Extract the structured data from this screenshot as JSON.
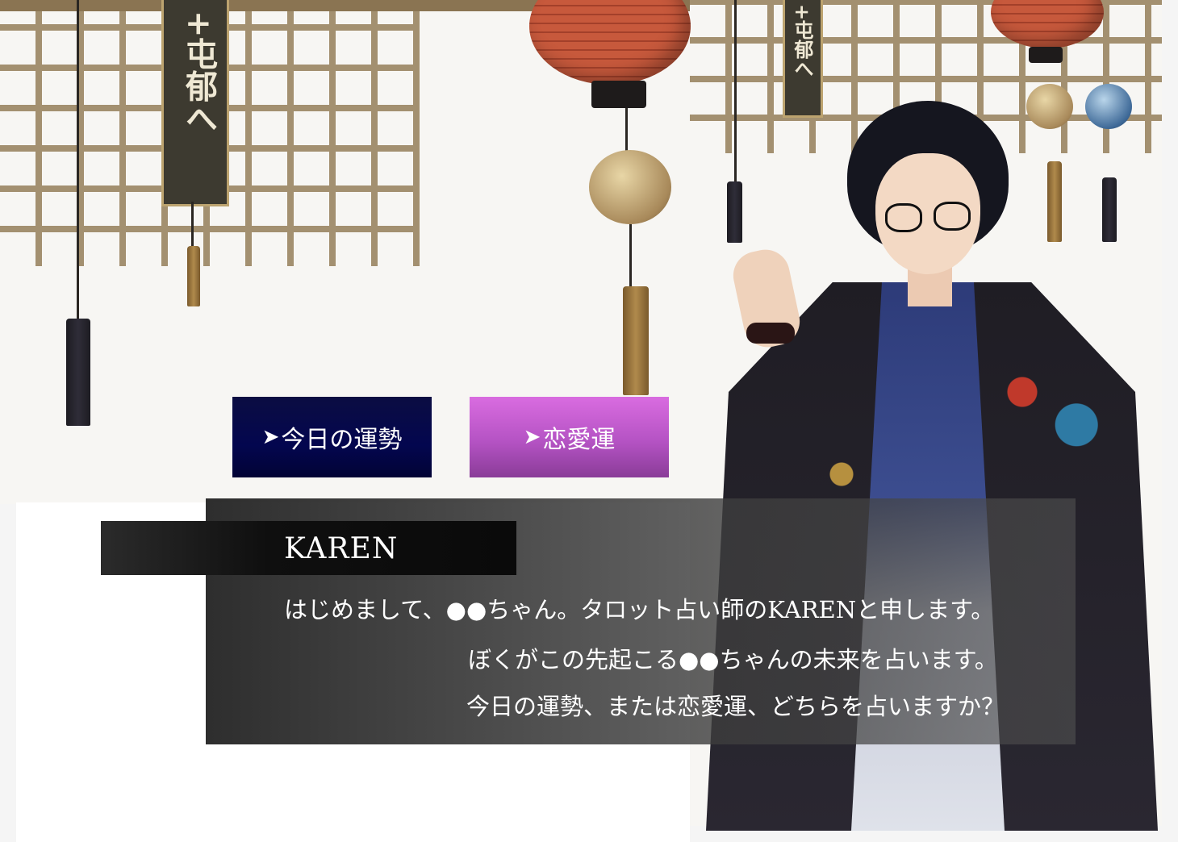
{
  "choices": [
    {
      "arrow": "➤",
      "label": "今日の運勢"
    },
    {
      "arrow": "➤",
      "label": "恋愛運"
    }
  ],
  "dialog": {
    "speaker": "KAREN",
    "lines": [
      "はじめまして、●●ちゃん。タロット占い師のKARENと申します。",
      "ぼくがこの先起こる●●ちゃんの未来を占います。",
      "今日の運勢、または恋愛運、どちらを占いますか？"
    ]
  },
  "scene": {
    "sign_text": "+屯郁へ",
    "colors": {
      "today_button": "#03064f",
      "love_button": "#b553c4",
      "dialog": "#3a3a3a"
    }
  }
}
